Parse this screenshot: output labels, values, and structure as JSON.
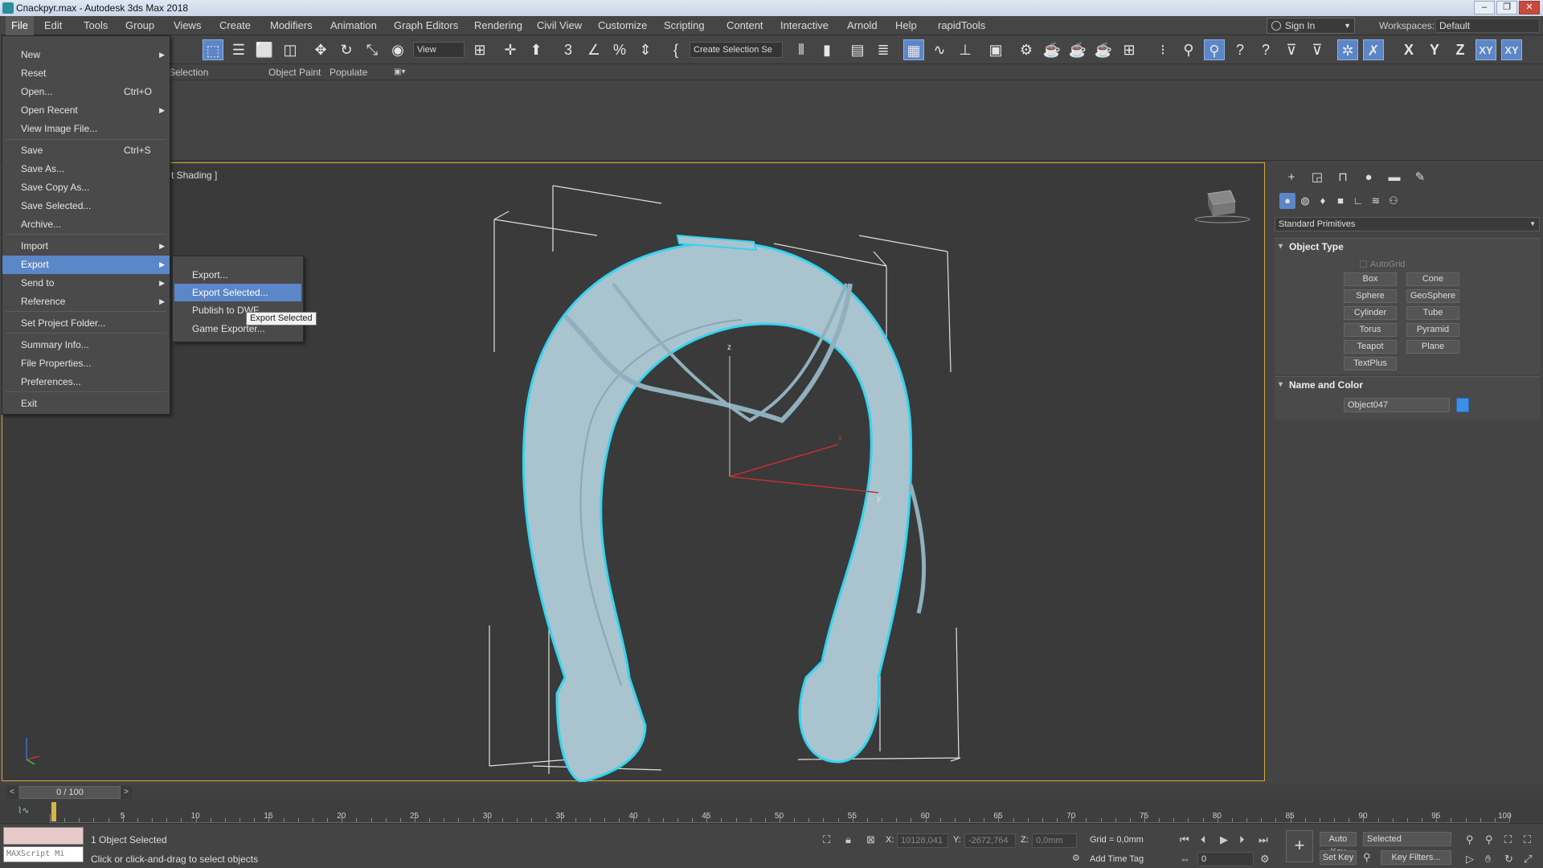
{
  "window": {
    "title": "Спасkруг.max - Autodesk 3ds Max 2018"
  },
  "menubar": {
    "items": [
      "File",
      "Edit",
      "Tools",
      "Group",
      "Views",
      "Create",
      "Modifiers",
      "Animation",
      "Graph Editors",
      "Rendering",
      "Civil View",
      "Customize",
      "Scripting",
      "Content",
      "Interactive",
      "Arnold",
      "Help",
      "rapidTools"
    ],
    "signin": "Sign In",
    "workspaces_label": "Workspaces:",
    "workspaces_value": "Default"
  },
  "toolbar": {
    "view_dropdown": "View",
    "selection_set": "Create Selection Se",
    "axis_labels": [
      "X",
      "Y",
      "Z",
      "XY",
      "XY"
    ]
  },
  "ribbon": {
    "tabs": [
      "Selection",
      "Object Paint",
      "Populate"
    ]
  },
  "viewport": {
    "label": "t Shading ]"
  },
  "file_menu": {
    "items": [
      {
        "label": "New",
        "shortcut": "",
        "submenu": true
      },
      {
        "label": "Reset",
        "shortcut": "",
        "submenu": false
      },
      {
        "label": "Open...",
        "shortcut": "Ctrl+O",
        "submenu": false
      },
      {
        "label": "Open Recent",
        "shortcut": "",
        "submenu": true
      },
      {
        "label": "View Image File...",
        "shortcut": "",
        "submenu": false
      },
      {
        "label": "Save",
        "shortcut": "Ctrl+S",
        "submenu": false
      },
      {
        "label": "Save As...",
        "shortcut": "",
        "submenu": false
      },
      {
        "label": "Save Copy As...",
        "shortcut": "",
        "submenu": false
      },
      {
        "label": "Save Selected...",
        "shortcut": "",
        "submenu": false
      },
      {
        "label": "Archive...",
        "shortcut": "",
        "submenu": false
      },
      {
        "label": "Import",
        "shortcut": "",
        "submenu": true
      },
      {
        "label": "Export",
        "shortcut": "",
        "submenu": true
      },
      {
        "label": "Send to",
        "shortcut": "",
        "submenu": true
      },
      {
        "label": "Reference",
        "shortcut": "",
        "submenu": true
      },
      {
        "label": "Set Project Folder...",
        "shortcut": "",
        "submenu": false
      },
      {
        "label": "Summary Info...",
        "shortcut": "",
        "submenu": false
      },
      {
        "label": "File Properties...",
        "shortcut": "",
        "submenu": false
      },
      {
        "label": "Preferences...",
        "shortcut": "",
        "submenu": false
      },
      {
        "label": "Exit",
        "shortcut": "",
        "submenu": false
      }
    ]
  },
  "export_submenu": {
    "items": [
      "Export...",
      "Export Selected...",
      "Publish to DWF...",
      "Game Exporter..."
    ],
    "tooltip": "Export Selected"
  },
  "command_panel": {
    "category": "Standard Primitives",
    "object_type_title": "Object Type",
    "autogrid": "AutoGrid",
    "buttons": [
      "Box",
      "Cone",
      "Sphere",
      "GeoSphere",
      "Cylinder",
      "Tube",
      "Torus",
      "Pyramid",
      "Teapot",
      "Plane",
      "TextPlus"
    ],
    "name_color_title": "Name and Color",
    "object_name": "Object047",
    "object_color": "#3d8fe6"
  },
  "timeline": {
    "slider": "0 / 100",
    "ticks": [
      5,
      10,
      15,
      20,
      25,
      30,
      35,
      40,
      45,
      50,
      55,
      60,
      65,
      70,
      75,
      80,
      85,
      90,
      95,
      100
    ]
  },
  "status": {
    "selected": "1 Object Selected",
    "prompt": "Click or click-and-drag to select objects",
    "maxscript": "MAXScript Mi",
    "x_label": "X:",
    "x_value": "10128,041",
    "y_label": "Y:",
    "y_value": "-2672,764",
    "z_label": "Z:",
    "z_value": "0,0mm",
    "grid": "Grid = 0,0mm",
    "add_time_tag": "Add Time Tag",
    "auto_key": "Auto Key",
    "set_key": "Set Key",
    "key_mode": "Selected",
    "key_filters": "Key Filters...",
    "frame": "0"
  }
}
